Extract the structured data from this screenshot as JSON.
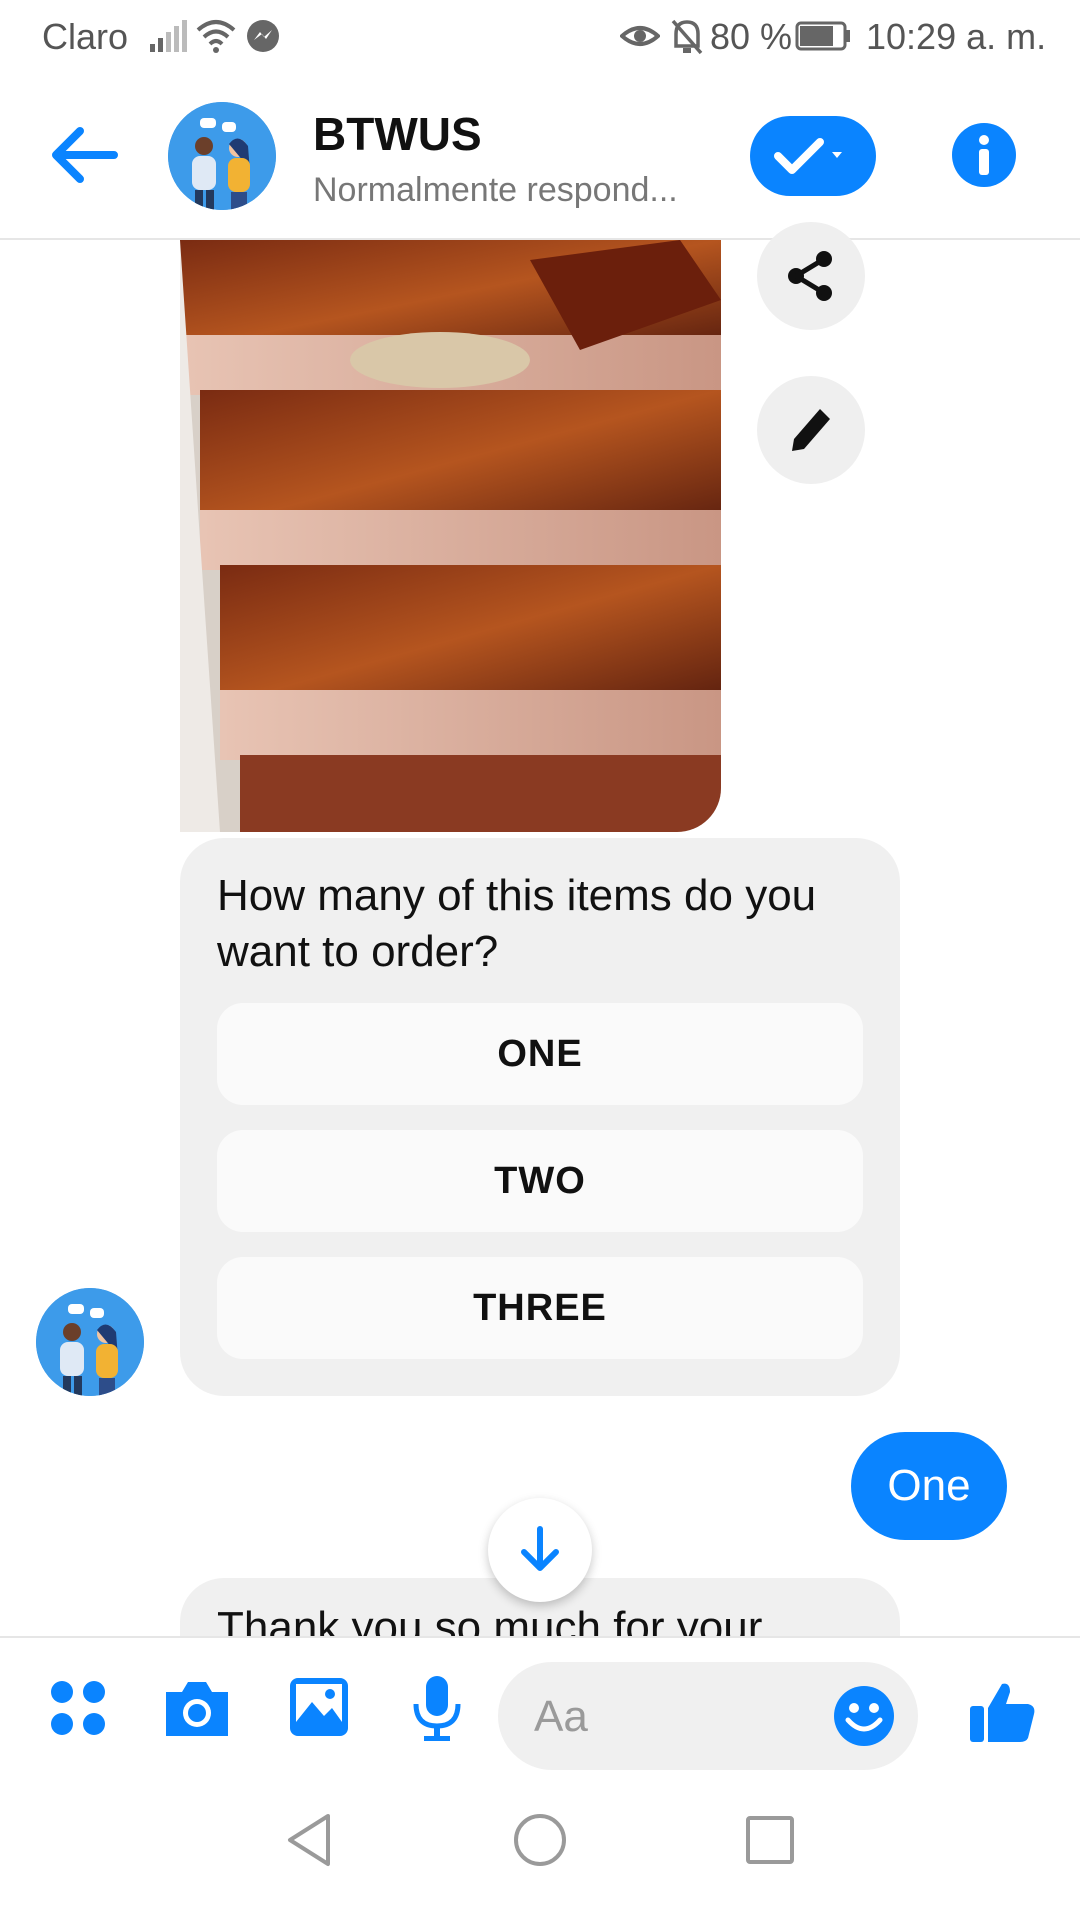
{
  "status_bar": {
    "carrier": "Claro",
    "battery": "80 %",
    "time": "10:29 a. m.",
    "icons": [
      "signal-icon",
      "wifi-icon",
      "messenger-icon",
      "eye-icon",
      "bell-off-icon",
      "battery-icon"
    ]
  },
  "header": {
    "title": "BTWUS",
    "subtitle": "Normalmente respond...",
    "icons": [
      "back-arrow-icon",
      "check-dropdown-icon",
      "info-icon"
    ]
  },
  "chat": {
    "question": "How many of this items do you want to order?",
    "quick_replies": [
      "ONE",
      "TWO",
      "THREE"
    ],
    "outgoing_reply": "One",
    "partial_message": "Thank you so much for your",
    "image_alt_icon": "food-photo",
    "side_icons": [
      "share-icon",
      "pencil-icon"
    ],
    "scroll_icon": "arrow-down-icon"
  },
  "composer": {
    "placeholder": "Aa",
    "icons": [
      "apps-icon",
      "camera-icon",
      "gallery-icon",
      "mic-icon",
      "emoji-icon",
      "thumbs-up-icon"
    ]
  },
  "colors": {
    "accent": "#0a84ff",
    "bubble": "#f0f0f0",
    "quick_reply": "#fafafa"
  }
}
